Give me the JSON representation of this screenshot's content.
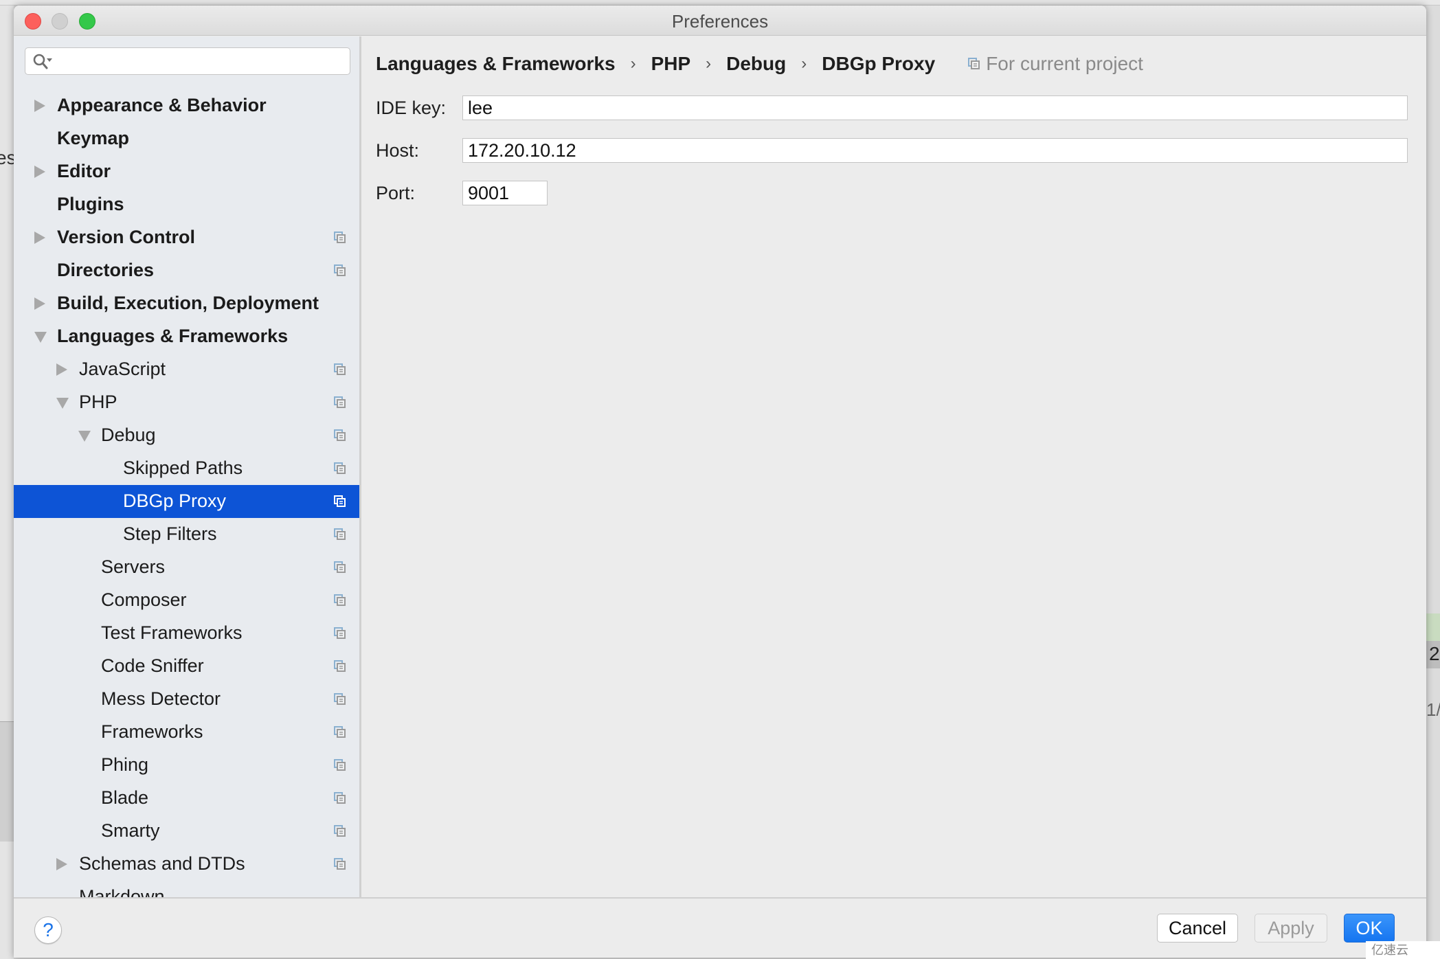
{
  "window": {
    "title": "Preferences"
  },
  "background": {
    "left_fragment": "es",
    "right_fragment_1": "2",
    "right_fragment_2": "1/"
  },
  "sidebar": {
    "search": {
      "value": "",
      "placeholder": ""
    },
    "items": [
      {
        "label": "Appearance & Behavior",
        "level": 0,
        "bold": true,
        "expander": "collapsed",
        "project_icon": false
      },
      {
        "label": "Keymap",
        "level": 0,
        "bold": true,
        "expander": "none",
        "project_icon": false
      },
      {
        "label": "Editor",
        "level": 0,
        "bold": true,
        "expander": "collapsed",
        "project_icon": false
      },
      {
        "label": "Plugins",
        "level": 0,
        "bold": true,
        "expander": "none",
        "project_icon": false
      },
      {
        "label": "Version Control",
        "level": 0,
        "bold": true,
        "expander": "collapsed",
        "project_icon": true
      },
      {
        "label": "Directories",
        "level": 0,
        "bold": true,
        "expander": "none",
        "project_icon": true
      },
      {
        "label": "Build, Execution, Deployment",
        "level": 0,
        "bold": true,
        "expander": "collapsed",
        "project_icon": false
      },
      {
        "label": "Languages & Frameworks",
        "level": 0,
        "bold": true,
        "expander": "expanded",
        "project_icon": false
      },
      {
        "label": "JavaScript",
        "level": 1,
        "bold": false,
        "expander": "collapsed",
        "project_icon": true
      },
      {
        "label": "PHP",
        "level": 1,
        "bold": false,
        "expander": "expanded",
        "project_icon": true
      },
      {
        "label": "Debug",
        "level": 2,
        "bold": false,
        "expander": "expanded",
        "project_icon": true
      },
      {
        "label": "Skipped Paths",
        "level": 3,
        "bold": false,
        "expander": "none",
        "project_icon": true
      },
      {
        "label": "DBGp Proxy",
        "level": 3,
        "bold": false,
        "expander": "none",
        "project_icon": true,
        "selected": true
      },
      {
        "label": "Step Filters",
        "level": 3,
        "bold": false,
        "expander": "none",
        "project_icon": true
      },
      {
        "label": "Servers",
        "level": 2,
        "bold": false,
        "expander": "none",
        "project_icon": true
      },
      {
        "label": "Composer",
        "level": 2,
        "bold": false,
        "expander": "none",
        "project_icon": true
      },
      {
        "label": "Test Frameworks",
        "level": 2,
        "bold": false,
        "expander": "none",
        "project_icon": true
      },
      {
        "label": "Code Sniffer",
        "level": 2,
        "bold": false,
        "expander": "none",
        "project_icon": true
      },
      {
        "label": "Mess Detector",
        "level": 2,
        "bold": false,
        "expander": "none",
        "project_icon": true
      },
      {
        "label": "Frameworks",
        "level": 2,
        "bold": false,
        "expander": "none",
        "project_icon": true
      },
      {
        "label": "Phing",
        "level": 2,
        "bold": false,
        "expander": "none",
        "project_icon": true
      },
      {
        "label": "Blade",
        "level": 2,
        "bold": false,
        "expander": "none",
        "project_icon": true
      },
      {
        "label": "Smarty",
        "level": 2,
        "bold": false,
        "expander": "none",
        "project_icon": true
      },
      {
        "label": "Schemas and DTDs",
        "level": 1,
        "bold": false,
        "expander": "collapsed",
        "project_icon": true
      },
      {
        "label": "Markdown",
        "level": 1,
        "bold": false,
        "expander": "none",
        "project_icon": false
      }
    ]
  },
  "content": {
    "breadcrumb": [
      "Languages & Frameworks",
      "PHP",
      "Debug",
      "DBGp Proxy"
    ],
    "breadcrumb_separator": "›",
    "scope_label": "For current project",
    "fields": {
      "ide_key": {
        "label": "IDE key:",
        "value": "lee"
      },
      "host": {
        "label": "Host:",
        "value": "172.20.10.12"
      },
      "port": {
        "label": "Port:",
        "value": "9001"
      }
    }
  },
  "footer": {
    "help_label": "?",
    "cancel_label": "Cancel",
    "apply_label": "Apply",
    "ok_label": "OK",
    "apply_enabled": false
  },
  "colors": {
    "selection": "#0d54d6",
    "ok_button": "#1a7af0",
    "sidebar_bg": "#e8ebef",
    "content_bg": "#ececec"
  },
  "watermark": "亿速云"
}
